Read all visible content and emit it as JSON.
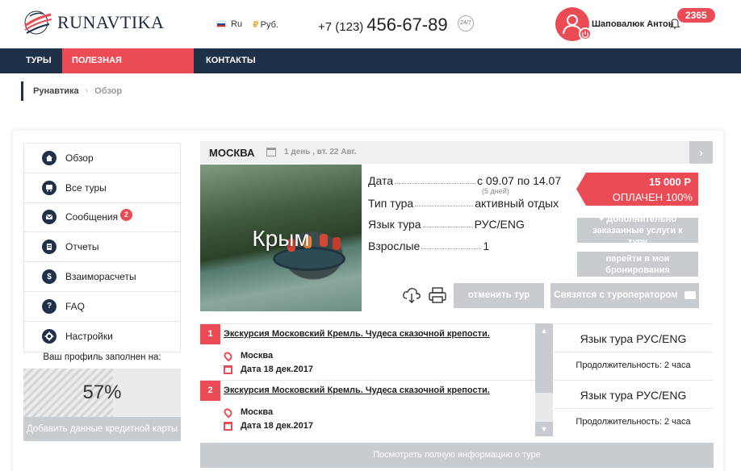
{
  "header": {
    "logo_text": "RUNAVTIKA",
    "language": "Ru",
    "currency": "Руб.",
    "currency_symbol": "₽",
    "phone_prefix": "+7 (123)",
    "phone_number": "456-67-89",
    "badge_247": "24/7",
    "user_name": "Шаповалюк Антон",
    "counter": "2365"
  },
  "nav": {
    "items": [
      {
        "label": "ТУРЫ"
      },
      {
        "label": "ПОЛЕЗНАЯ ИНФОРМАЦИЯ"
      },
      {
        "label": "КОНТАКТЫ"
      }
    ]
  },
  "breadcrumb": {
    "items": [
      "Рунавтика",
      "Обзор"
    ],
    "separator": "›"
  },
  "sidebar": {
    "items": [
      {
        "label": "Обзор",
        "icon": "home-icon"
      },
      {
        "label": "Все туры",
        "icon": "bus-icon"
      },
      {
        "label": "Сообщения",
        "icon": "envelope-icon",
        "badge": "2"
      },
      {
        "label": "Отчеты",
        "icon": "document-icon"
      },
      {
        "label": "Взаиморасчеты",
        "icon": "dollar-icon"
      },
      {
        "label": "FAQ",
        "icon": "question-icon"
      },
      {
        "label": "Настройки",
        "icon": "gear-icon"
      }
    ],
    "profile_label": "Ваш профиль заполнен на:",
    "profile_percent": "57%",
    "profile_fraction": 0.57,
    "add_card_label": "Добавить данные кредитной карты"
  },
  "tour": {
    "city": "МОСКВА",
    "dates": "1 день , вт. 22 Авг.",
    "next_arrow": "›",
    "photo_title": "Крым",
    "details": [
      {
        "label": "Дата",
        "value": "с 09.07 по 14.07"
      },
      {
        "label": "Тип тура",
        "value": "активный отдых"
      },
      {
        "label": "Язык тура",
        "value": "РУС/ENG"
      },
      {
        "label": "Взрослые",
        "value": "1"
      }
    ],
    "date_sub": "(5 дней)",
    "price": "15 000 Р",
    "payment_status": "ОПЛАЧЕН 100%",
    "extra_services_btn": "+ Дополнительно заказанные услуги к туру",
    "booking_btn": "перейти в мои бронирования",
    "cancel_btn": "отменить тур",
    "contact_btn": "Связятся с туроператором",
    "full_info_btn": "Посмотреть полную информацию о туре"
  },
  "excursions": [
    {
      "num": "1",
      "title": "Экскурсия Московский Кремль. Чудеса сказочной крепости.",
      "city": "Москва",
      "date": "Дата 18 дек.2017",
      "language": "Язык тура РУС/ENG",
      "duration": "Продолжительность: 2 часа"
    },
    {
      "num": "2",
      "title": "Экскурсия Московский Кремль. Чудеса сказочной крепости.",
      "city": "Москва",
      "date": "Дата 18 дек.2017",
      "language": "Язык тура РУС/ENG",
      "duration": "Продолжительность: 2 часа"
    }
  ],
  "colors": {
    "accent": "#ea4b54",
    "navy": "#1f3149",
    "button_gray": "#c8ccd1"
  }
}
